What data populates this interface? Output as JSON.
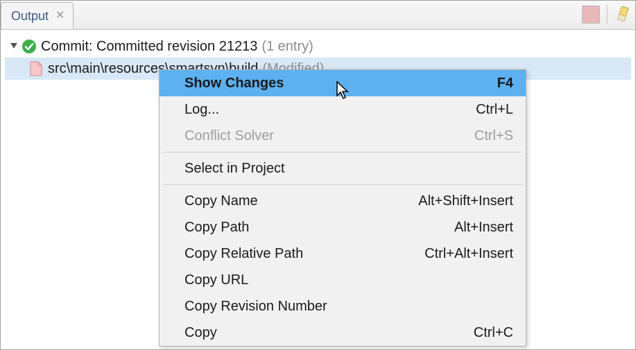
{
  "tab": {
    "label": "Output"
  },
  "tree": {
    "commit_label_prefix": "Commit: Committed revision 21213",
    "commit_entry_suffix": "(1 entry)",
    "file_path": "src\\main\\resources\\smartsvn\\build",
    "file_status": "(Modified)"
  },
  "menu": {
    "items": [
      {
        "label": "Show Changes",
        "shortcut": "F4",
        "highlighted": true
      },
      {
        "label": "Log...",
        "shortcut": "Ctrl+L"
      },
      {
        "label": "Conflict Solver",
        "shortcut": "Ctrl+S",
        "disabled": true
      },
      {
        "separator": true
      },
      {
        "label": "Select in Project",
        "shortcut": ""
      },
      {
        "separator": true
      },
      {
        "label": "Copy Name",
        "shortcut": "Alt+Shift+Insert"
      },
      {
        "label": "Copy Path",
        "shortcut": "Alt+Insert"
      },
      {
        "label": "Copy Relative Path",
        "shortcut": "Ctrl+Alt+Insert"
      },
      {
        "label": "Copy URL",
        "shortcut": ""
      },
      {
        "label": "Copy Revision Number",
        "shortcut": ""
      },
      {
        "label": "Copy",
        "shortcut": "Ctrl+C"
      }
    ]
  }
}
